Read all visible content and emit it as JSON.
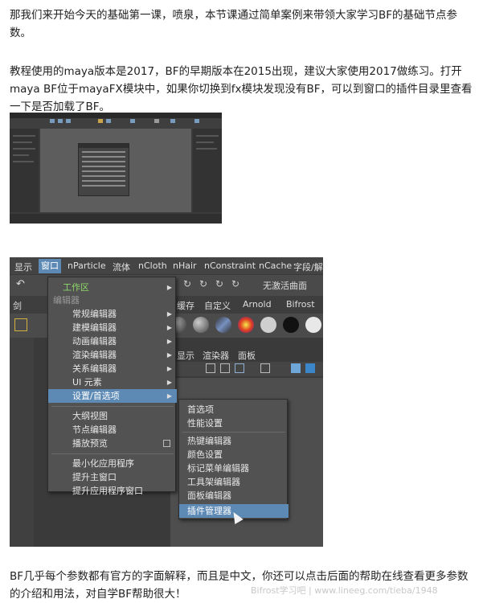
{
  "paragraphs": {
    "p1": "那我们来开始今天的基础第一课，喷泉，本节课通过简单案例来带领大家学习BF的基础节点参数。",
    "p2": "教程使用的maya版本是2017，BF的早期版本在2015出现，建议大家使用2017做练习。打开maya  BF位于mayaFX模块中，如果你切换到fx模块发现没有BF，可以到窗口的插件目录里查看一下是否加载了BF。",
    "p3": "BF几乎每个参数都有官方的字面解释，而且是中文，你还可以点击后面的帮助在线查看更多参数的介绍和用法，对自学BF帮助很大！"
  },
  "maya_menubar": [
    "显示",
    "窗口",
    "nParticle",
    "流体",
    "nCloth",
    "nHair",
    "nConstraint",
    "nCache",
    "字段/解"
  ],
  "toolbar": {
    "dropdown": "无激活曲面"
  },
  "shelf_tabs": [
    "剑",
    "缓存",
    "自定义",
    "Arnold",
    "Bifrost"
  ],
  "view_header": [
    "显示",
    "渲染器",
    "面板"
  ],
  "window_menu": {
    "workspace": "工作区",
    "editors_header": "编辑器",
    "items": [
      "常规编辑器",
      "建模编辑器",
      "动画编辑器",
      "渲染编辑器",
      "关系编辑器",
      "UI 元素",
      "设置/首选项",
      "大纲视图",
      "节点编辑器",
      "播放预览",
      "最小化应用程序",
      "提升主窗口",
      "提升应用程序窗口"
    ]
  },
  "sub_menu": {
    "items": [
      "首选项",
      "性能设置",
      "热键编辑器",
      "颜色设置",
      "标记菜单编辑器",
      "工具架编辑器",
      "面板编辑器",
      "插件管理器"
    ]
  },
  "watermark": "Bifrost学习吧 | www.lineeg.com/tieba/1948",
  "colors": {
    "highlight": "#5d8ab5",
    "workspace_green": "#8fd66b"
  }
}
